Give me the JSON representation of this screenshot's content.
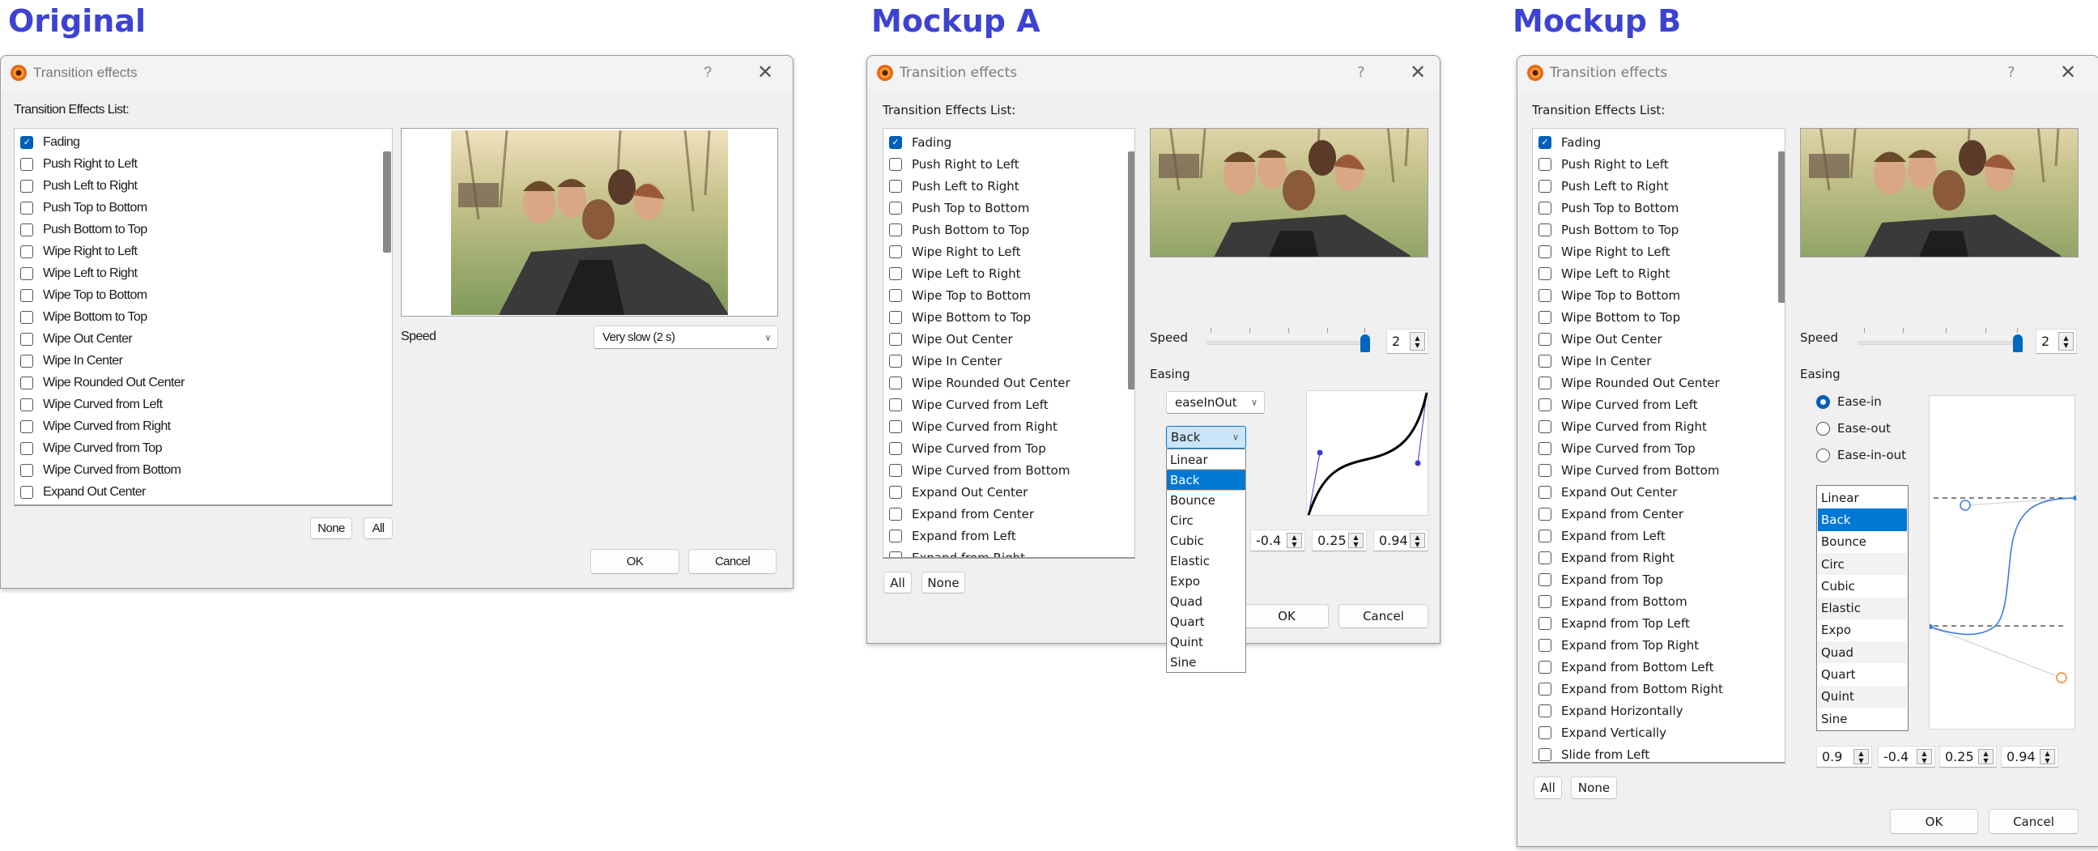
{
  "headings": {
    "original": "Original",
    "mockup_a": "Mockup A",
    "mockup_b": "Mockup B"
  },
  "colors": {
    "accent": "#0078d4",
    "heading": "#3d43d0"
  },
  "original": {
    "title": "Transition effects",
    "help": "?",
    "close": "✕",
    "list_label": "Transition Effects List:",
    "effects": [
      "Fading",
      "Push Right to Left",
      "Push Left to Right",
      "Push Top to Bottom",
      "Push Bottom to Top",
      "Wipe Right to Left",
      "Wipe Left to Right",
      "Wipe Top to Bottom",
      "Wipe Bottom to Top",
      "Wipe Out Center",
      "Wipe In Center",
      "Wipe Rounded Out Center",
      "Wipe Curved from Left",
      "Wipe Curved from Right",
      "Wipe Curved from Top",
      "Wipe Curved from Bottom",
      "Expand Out Center"
    ],
    "checked": [
      0
    ],
    "speed_label": "Speed",
    "speed_value": "Very slow (2 s)",
    "none": "None",
    "all": "All",
    "ok": "OK",
    "cancel": "Cancel"
  },
  "mockup_a": {
    "title": "Transition effects",
    "help": "?",
    "close": "✕",
    "list_label": "Transition Effects List:",
    "effects": [
      "Fading",
      "Push Right to Left",
      "Push Left to Right",
      "Push Top to Bottom",
      "Push Bottom to Top",
      "Wipe Right to Left",
      "Wipe Left to Right",
      "Wipe Top to Bottom",
      "Wipe Bottom to Top",
      "Wipe Out Center",
      "Wipe In Center",
      "Wipe Rounded Out Center",
      "Wipe Curved from Left",
      "Wipe Curved from Right",
      "Wipe Curved from Top",
      "Wipe Curved from Bottom",
      "Expand Out Center",
      "Expand from Center",
      "Expand from Left",
      "Expand from Right"
    ],
    "checked": [
      0
    ],
    "speed_label": "Speed",
    "speed_value": "2",
    "speed_fraction": 1.0,
    "easing_label": "Easing",
    "easing_mode": "easeInOut",
    "easing_type": "Back",
    "easing_options": [
      "Linear",
      "Back",
      "Bounce",
      "Circ",
      "Cubic",
      "Elastic",
      "Expo",
      "Quad",
      "Quart",
      "Quint",
      "Sine"
    ],
    "easing_selected": 1,
    "params": [
      "-0.4",
      "0.25",
      "0.94"
    ],
    "all": "All",
    "none": "None",
    "ok": "OK",
    "cancel": "Cancel"
  },
  "mockup_b": {
    "title": "Transition effects",
    "help": "?",
    "close": "✕",
    "list_label": "Transition Effects List:",
    "effects": [
      "Fading",
      "Push Right to Left",
      "Push Left to Right",
      "Push Top to Bottom",
      "Push Bottom to Top",
      "Wipe Right to Left",
      "Wipe Left to Right",
      "Wipe Top to Bottom",
      "Wipe Bottom to Top",
      "Wipe Out Center",
      "Wipe In Center",
      "Wipe Rounded Out Center",
      "Wipe Curved from Left",
      "Wipe Curved from Right",
      "Wipe Curved from Top",
      "Wipe Curved from Bottom",
      "Expand Out Center",
      "Expand from Center",
      "Expand from Left",
      "Expand from Right",
      "Expand from Top",
      "Expand from Bottom",
      "Exapnd from Top Left",
      "Expand from Top Right",
      "Expand from Bottom Left",
      "Expand from Bottom Right",
      "Expand Horizontally",
      "Expand Vertically",
      "Slide from Left"
    ],
    "checked": [
      0
    ],
    "speed_label": "Speed",
    "speed_value": "2",
    "speed_fraction": 1.0,
    "easing_label": "Easing",
    "radios": [
      "Ease-in",
      "Ease-out",
      "Ease-in-out"
    ],
    "radio_selected": 0,
    "easing_options": [
      "Linear",
      "Back",
      "Bounce",
      "Circ",
      "Cubic",
      "Elastic",
      "Expo",
      "Quad",
      "Quart",
      "Quint",
      "Sine"
    ],
    "easing_selected": 1,
    "params": [
      "0.9",
      "-0.4",
      "0.25",
      "0.94"
    ],
    "all": "All",
    "none": "None",
    "ok": "OK",
    "cancel": "Cancel"
  }
}
